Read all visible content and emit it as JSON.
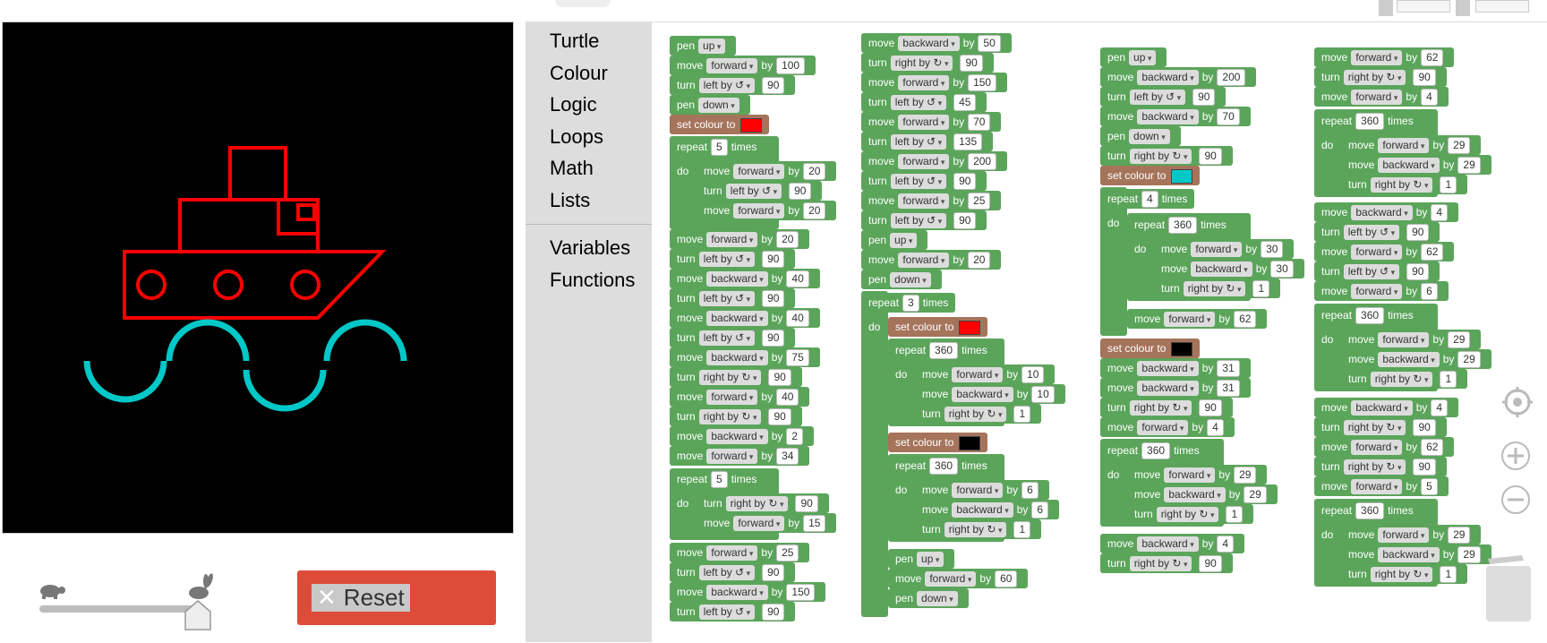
{
  "toolbox": {
    "categories": [
      "Turtle",
      "Colour",
      "Logic",
      "Loops",
      "Math",
      "Lists"
    ],
    "extra_categories": [
      "Variables",
      "Functions"
    ]
  },
  "reset_label": "Reset",
  "blocks": {
    "pen": "pen",
    "move": "move",
    "turn": "turn",
    "by": "by",
    "repeat": "repeat",
    "times": "times",
    "do": "do",
    "set_colour_to": "set colour to",
    "up": "up",
    "down": "down",
    "forward": "forward",
    "backward": "backward",
    "left_by": "left by ↺",
    "right_by": "right by ↻"
  },
  "colors": {
    "ship": "#ff0000",
    "waves": "#00c8c8",
    "black": "#000000",
    "block_green": "#5ba55b",
    "colour_block": "#a5745b",
    "reset": "#dd4b39"
  },
  "icons": [
    "turtle-icon",
    "rabbit-icon",
    "close-icon",
    "crosshair-icon",
    "zoom-in-icon",
    "zoom-out-icon",
    "trash-icon"
  ]
}
